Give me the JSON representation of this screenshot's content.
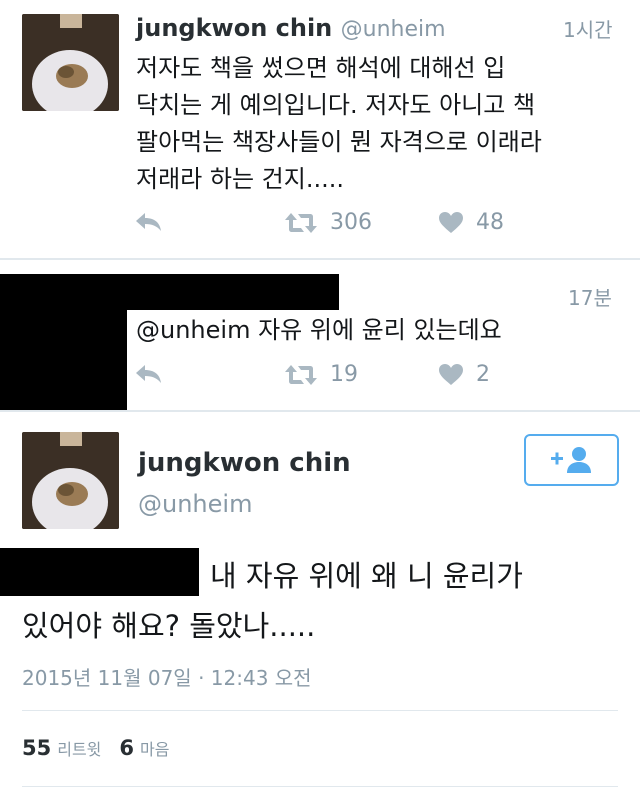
{
  "tweet1": {
    "display_name": "jungkwon chin",
    "handle": "@unheim",
    "time": "1시간",
    "text_lines": [
      "저자도 책을 썼으면 해석에 대해선 입",
      "닥치는 게 예의입니다. 저자도 아니고 책",
      "팔아먹는 책장사들이 뭔 자격으로 이래라",
      "저래라 하는 건지....."
    ],
    "retweets": "306",
    "likes": "48"
  },
  "tweet2": {
    "time": "17분",
    "text": "@unheim 자유 위에 윤리 있는데요",
    "retweets": "19",
    "likes": "2"
  },
  "tweet3": {
    "display_name": "jungkwon chin",
    "handle": "@unheim",
    "text_line1": "내 자유 위에 왜 니 윤리가",
    "text_line2": "있어야 해요? 돌았나.....",
    "datetime": "2015년 11월 07일 · 12:43 오전",
    "retweet_count": "55",
    "retweet_label": "리트윗",
    "like_count": "6",
    "like_label": "마음"
  },
  "icons": [
    "reply-icon",
    "retweet-icon",
    "heart-icon",
    "follow-user-icon"
  ],
  "colors": {
    "accent": "#55acee",
    "muted": "#8899a6",
    "icon": "#aab8c2",
    "divider": "#e1e8ed"
  }
}
